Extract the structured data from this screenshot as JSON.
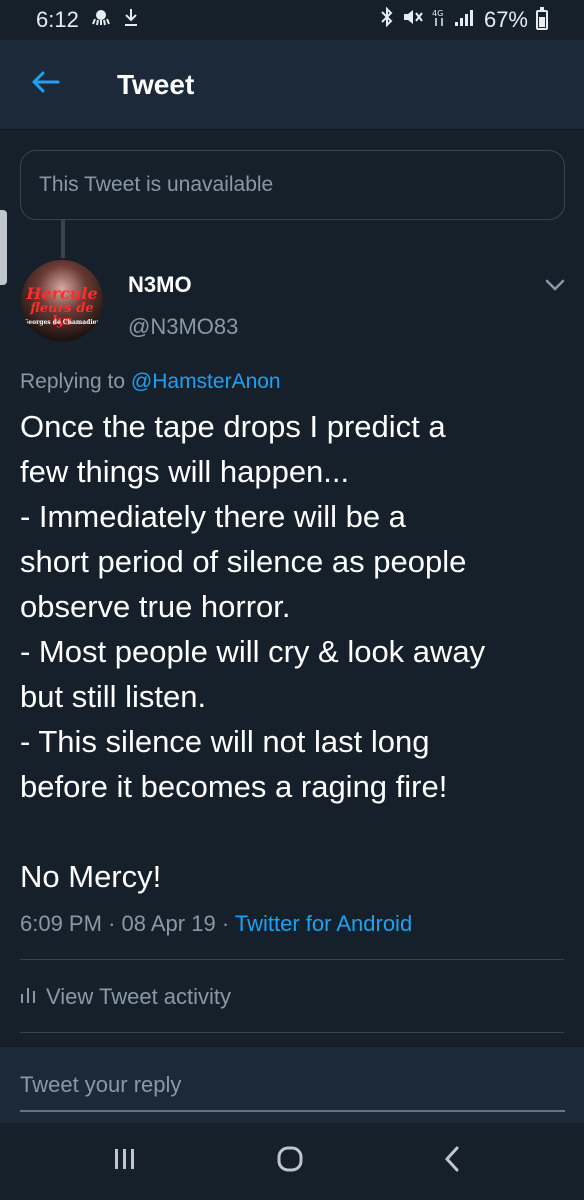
{
  "status_bar": {
    "time": "6:12",
    "battery": "67%",
    "icons": [
      "octopus-icon",
      "download-icon",
      "bluetooth-icon",
      "mute-icon",
      "4g-icon",
      "signal-icon",
      "battery-icon"
    ]
  },
  "header": {
    "title": "Tweet",
    "back_icon": "back-arrow-icon"
  },
  "unavailable_notice": "This Tweet is unavailable",
  "author": {
    "name": "N3MO",
    "handle": "@N3MO83",
    "avatar_text": [
      "Hercule",
      "fleurs de lys",
      "Georges de Chamadien"
    ]
  },
  "tweet": {
    "replying_prefix": "Replying to ",
    "replying_to": "@HamsterAnon",
    "lines": [
      "Once the tape drops I predict a",
      "few things will happen...",
      "- Immediately there will be a",
      "short period of silence as people",
      "observe true horror.",
      "- Most people will cry & look away",
      "but still listen.",
      "- This silence will not last long",
      "before it becomes a raging fire!",
      "",
      "No Mercy!"
    ],
    "time": "6:09 PM",
    "date": "08 Apr 19",
    "separator": "·",
    "source": "Twitter for Android"
  },
  "activity": {
    "label": "View Tweet activity",
    "icon": "bar-chart-icon"
  },
  "reply": {
    "placeholder": "Tweet your reply"
  },
  "nav": {
    "recent": "recent-apps-icon",
    "home": "home-icon",
    "back": "back-icon"
  },
  "colors": {
    "background": "#15202b",
    "header": "#1c2938",
    "accent": "#1da1f2",
    "secondary_text": "#8899a6",
    "border": "#38444d"
  }
}
